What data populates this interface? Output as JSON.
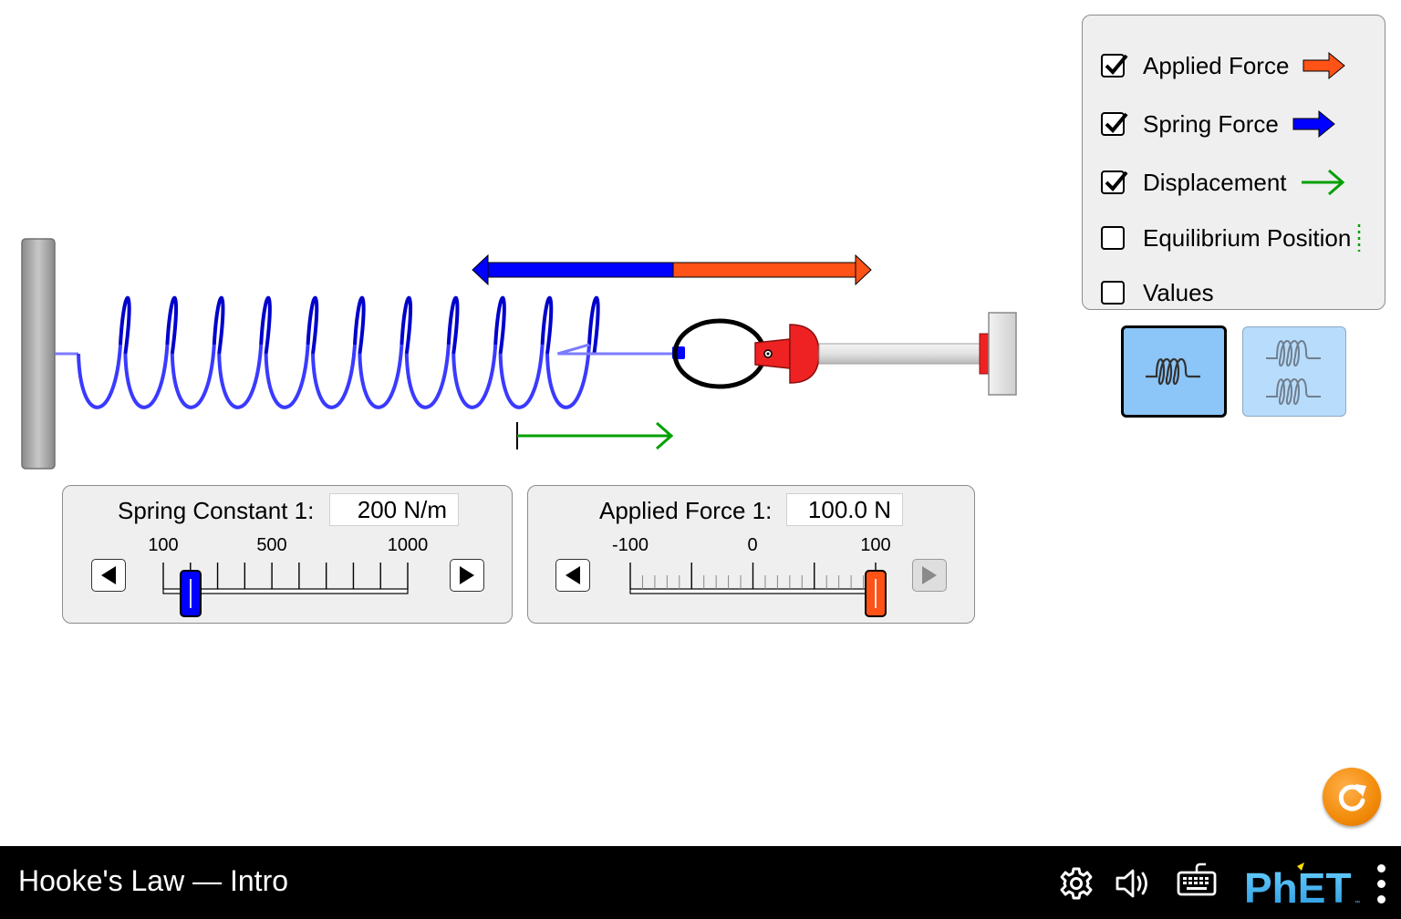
{
  "navbar": {
    "title": "Hooke's Law — Intro",
    "icons": [
      "gear-icon",
      "speaker-icon",
      "keyboard-icon"
    ],
    "logo": "PhET"
  },
  "visibility_panel": {
    "items": [
      {
        "label": "Applied Force",
        "checked": true,
        "icon": "applied-force-arrow-icon",
        "color": "#ff5217"
      },
      {
        "label": "Spring Force",
        "checked": true,
        "icon": "spring-force-arrow-icon",
        "color": "#0000ff"
      },
      {
        "label": "Displacement",
        "checked": true,
        "icon": "displacement-arrow-icon",
        "color": "#00a000"
      },
      {
        "label": "Equilibrium Position",
        "checked": false,
        "icon": "equilibrium-dotted-line-icon",
        "color": "#00a000"
      },
      {
        "label": "Values",
        "checked": false
      }
    ]
  },
  "scene_selector": {
    "options": [
      "one-spring",
      "two-springs"
    ],
    "selected": "one-spring"
  },
  "spring_constant_control": {
    "title": "Spring Constant 1:",
    "value": "200 N/m",
    "value_number": 200,
    "min": 100,
    "max": 1000,
    "tick_labels": [
      "100",
      "500",
      "1000"
    ],
    "color": "#0000ff"
  },
  "applied_force_control": {
    "title": "Applied Force 1:",
    "value": "100.0 N",
    "value_number": 100,
    "min": -100,
    "max": 100,
    "tick_labels": [
      "-100",
      "0",
      "100"
    ],
    "color": "#ff5217"
  },
  "colors": {
    "spring": "#0000cc",
    "applied_force": "#ff5217",
    "spring_force": "#0000ff",
    "displacement": "#00a000",
    "reset": "#f28b0a"
  }
}
